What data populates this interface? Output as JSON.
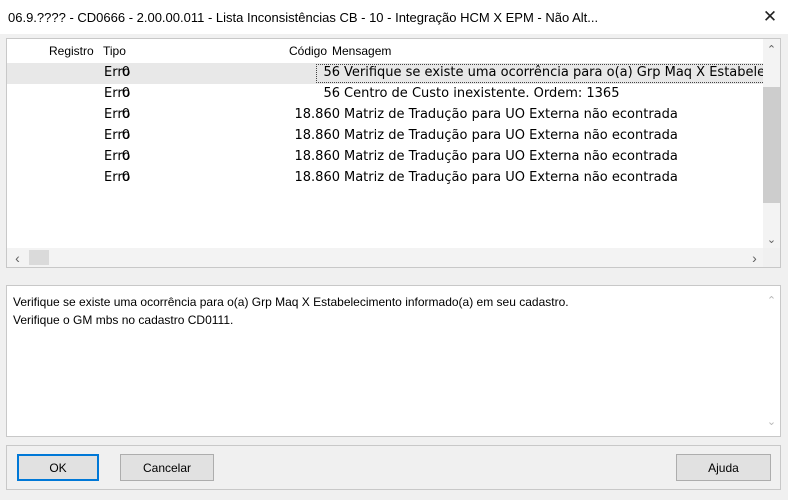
{
  "window": {
    "title": "06.9.???? - CD0666 - 2.00.00.011 - Lista Inconsistências CB - 10 - Integração HCM X EPM - Não Alt...",
    "close_glyph": "✕"
  },
  "grid": {
    "columns": {
      "registro": "Registro",
      "tipo": "Tipo",
      "codigo": "Código",
      "mensagem": "Mensagem"
    },
    "rows": [
      {
        "registro": "0",
        "tipo": "Erro",
        "codigo": "56",
        "mensagem": "Verifique se existe uma ocorrência para o(a) Grp Maq X Estabelecimento informado(a) em seu cadastro."
      },
      {
        "registro": "0",
        "tipo": "Erro",
        "codigo": "56",
        "mensagem": "Centro de Custo inexistente.  Ordem: 1365"
      },
      {
        "registro": "0",
        "tipo": "Erro",
        "codigo": "18.860",
        "mensagem": "Matriz de Tradução para UO Externa não econtrada"
      },
      {
        "registro": "0",
        "tipo": "Erro",
        "codigo": "18.860",
        "mensagem": "Matriz de Tradução para UO Externa não econtrada"
      },
      {
        "registro": "0",
        "tipo": "Erro",
        "codigo": "18.860",
        "mensagem": "Matriz de Tradução para UO Externa não econtrada"
      },
      {
        "registro": "0",
        "tipo": "Erro",
        "codigo": "18.860",
        "mensagem": "Matriz de Tradução para UO Externa não econtrada"
      }
    ],
    "selected_index": 0
  },
  "detail": {
    "lines": [
      "Verifique se existe uma ocorrência para o(a) Grp Maq X Estabelecimento informado(a) em seu cadastro.",
      "Verifique o GM mbs no cadastro CD0111."
    ]
  },
  "buttons": {
    "ok": "OK",
    "cancel": "Cancelar",
    "help": "Ajuda"
  },
  "icons": {
    "up": "⌃",
    "down": "⌄",
    "left": "‹",
    "right": "›"
  },
  "colors": {
    "accent": "#0078d7"
  }
}
